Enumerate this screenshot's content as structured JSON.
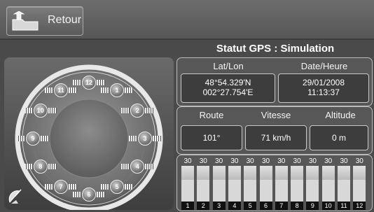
{
  "header": {
    "back_label": "Retour"
  },
  "title": "Statut GPS : Simulation",
  "position": {
    "latlon_label": "Lat/Lon",
    "lat": "48°54.329'N",
    "lon": "002°27.754'E",
    "datetime_label": "Date/Heure",
    "date": "29/01/2008",
    "time": "11:13:37"
  },
  "motion": {
    "route_label": "Route",
    "route": "101°",
    "speed_label": "Vitesse",
    "speed": "71 km/h",
    "altitude_label": "Altitude",
    "altitude": "0 m"
  },
  "satellites": {
    "ids": [
      "1",
      "2",
      "3",
      "4",
      "5",
      "6",
      "7",
      "8",
      "9",
      "10",
      "11",
      "12"
    ]
  },
  "signal": {
    "values": [
      "30",
      "30",
      "30",
      "30",
      "30",
      "30",
      "30",
      "30",
      "30",
      "30",
      "30",
      "30"
    ],
    "labels": [
      "1",
      "2",
      "3",
      "4",
      "5",
      "6",
      "7",
      "8",
      "9",
      "10",
      "11",
      "12"
    ]
  },
  "colors": {
    "background": "#555555",
    "panel": "#575757",
    "value_box": "#3d3d3d"
  },
  "icons": {
    "back": "folder-up-arrow-icon",
    "satellite": "satellite-dish-icon"
  }
}
